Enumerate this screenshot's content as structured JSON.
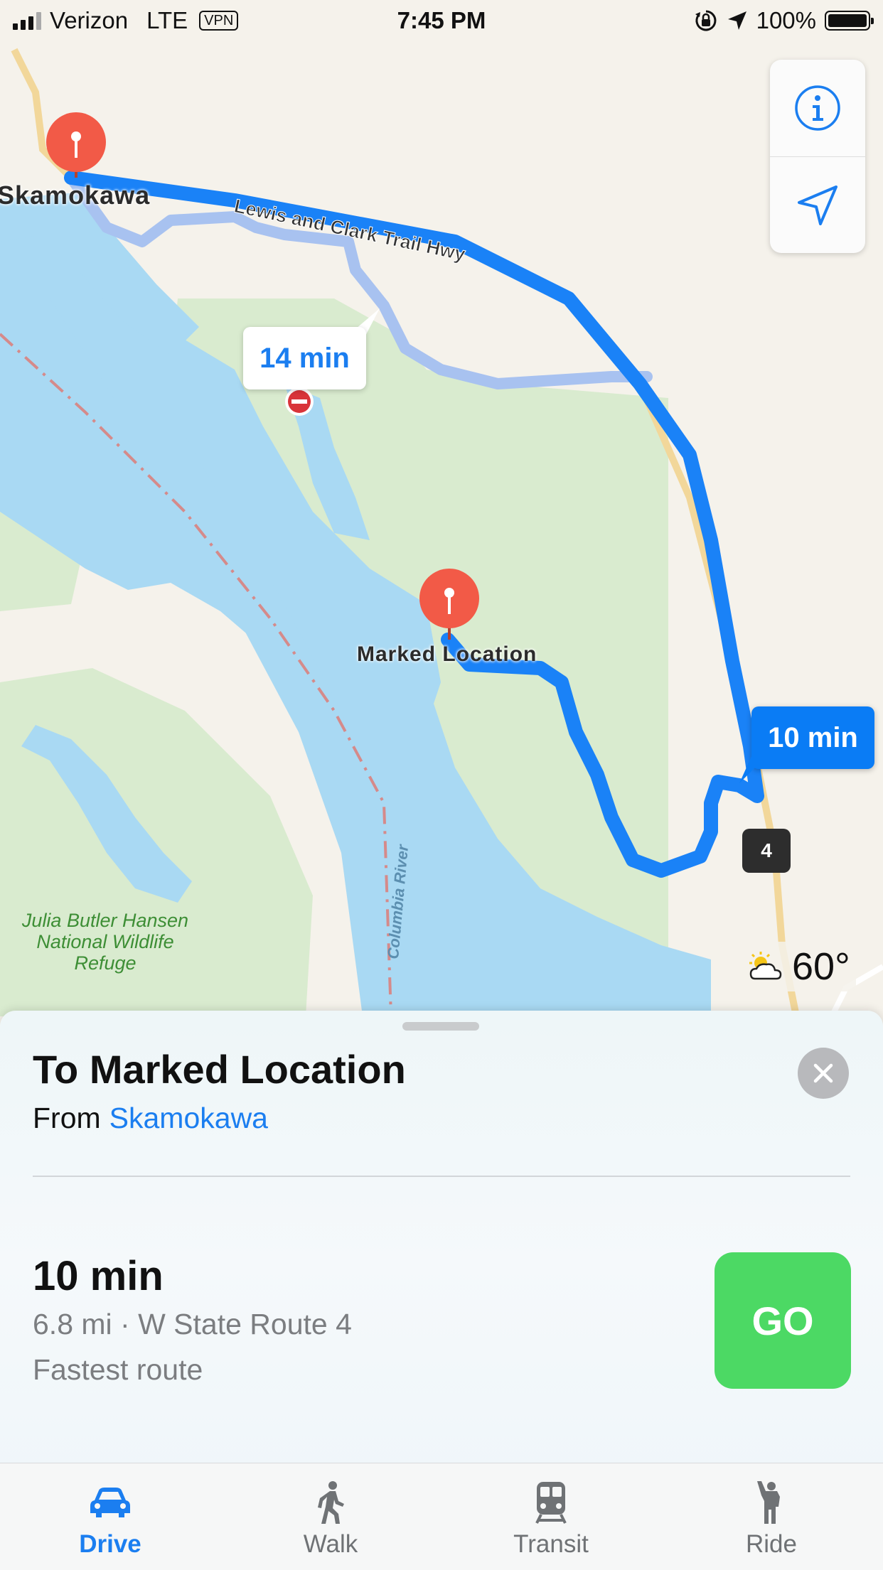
{
  "status_bar": {
    "carrier": "Verizon",
    "network": "LTE",
    "vpn": "VPN",
    "time": "7:45 PM",
    "battery": "100%",
    "battery_level": 1.0
  },
  "map": {
    "town_label": "Skamokawa",
    "road_label": "Lewis and Clark Trail Hwy",
    "destination_label": "Marked Location",
    "river_label": "Columbia River",
    "refuge_label": "Julia Butler Hansen National Wildlife Refuge",
    "alt_route_time": "14 min",
    "main_route_time": "10 min",
    "route_shield": "4",
    "weather_temp": "60°",
    "colors": {
      "water": "#a9d9f3",
      "land": "#f5f2eb",
      "park": "#d9ebcf",
      "route": "#1a82f7",
      "alt_route": "#a8c2f0",
      "pin": "#f25a47"
    }
  },
  "controls": {
    "info_icon": "info-icon",
    "location_icon": "location-arrow-icon"
  },
  "sheet": {
    "title": "To Marked Location",
    "from_prefix": "From",
    "from_origin": "Skamokawa",
    "route_time": "10 min",
    "route_detail": "6.8 mi · W State Route 4",
    "route_desc": "Fastest route",
    "go_label": "GO"
  },
  "tabs": [
    {
      "label": "Drive",
      "icon": "car-icon",
      "active": true
    },
    {
      "label": "Walk",
      "icon": "walk-icon",
      "active": false
    },
    {
      "label": "Transit",
      "icon": "train-icon",
      "active": false
    },
    {
      "label": "Ride",
      "icon": "ride-icon",
      "active": false
    }
  ],
  "accent": "#1b7ef0",
  "go_color": "#4cd964"
}
